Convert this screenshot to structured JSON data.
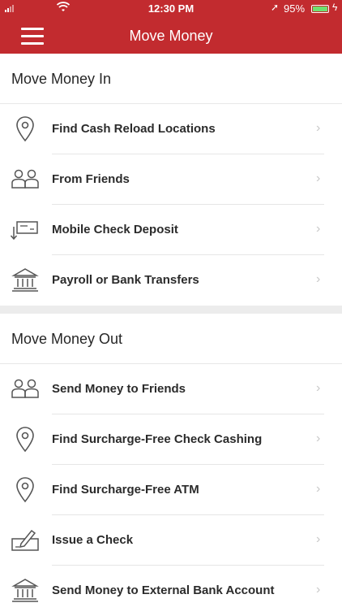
{
  "status_bar": {
    "time": "12:30 PM",
    "battery": "95%"
  },
  "nav": {
    "title": "Move Money"
  },
  "sections": [
    {
      "title": "Move Money In",
      "items": [
        {
          "label": "Find Cash Reload Locations",
          "icon": "location-pin-icon"
        },
        {
          "label": "From Friends",
          "icon": "people-icon"
        },
        {
          "label": "Mobile Check Deposit",
          "icon": "check-deposit-icon"
        },
        {
          "label": "Payroll or Bank Transfers",
          "icon": "bank-icon"
        }
      ]
    },
    {
      "title": "Move Money Out",
      "items": [
        {
          "label": "Send Money to Friends",
          "icon": "people-icon"
        },
        {
          "label": "Find Surcharge-Free Check Cashing",
          "icon": "location-pin-icon"
        },
        {
          "label": "Find Surcharge-Free ATM",
          "icon": "location-pin-icon"
        },
        {
          "label": "Issue a Check",
          "icon": "write-check-icon"
        },
        {
          "label": "Send Money to External Bank Account",
          "icon": "bank-icon"
        }
      ]
    }
  ],
  "colors": {
    "brand": "#c22b2f",
    "section_gap": "#ececec"
  }
}
